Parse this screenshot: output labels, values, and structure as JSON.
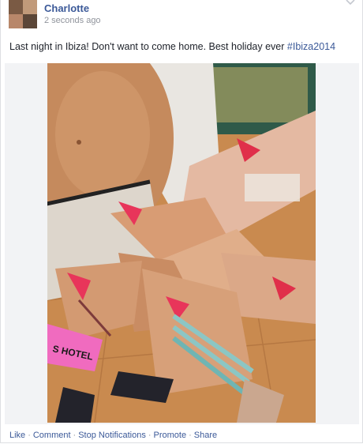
{
  "post": {
    "author": "Charlotte",
    "timestamp": "2 seconds ago",
    "text": "Last night in Ibiza! Don't want to come home. Best holiday ever ",
    "hashtag": "#Ibiza2014",
    "photo_wristband_text": "S HOTEL"
  },
  "actions": {
    "like": "Like",
    "separator": "·",
    "comment": "Comment",
    "stop_notifications": "Stop Notifications",
    "promote": "Promote",
    "share": "Share"
  },
  "icons": {
    "chevron": "chevron-down-icon"
  },
  "colors": {
    "link": "#3b5998",
    "meta": "#90949c",
    "text": "#1d2129"
  }
}
